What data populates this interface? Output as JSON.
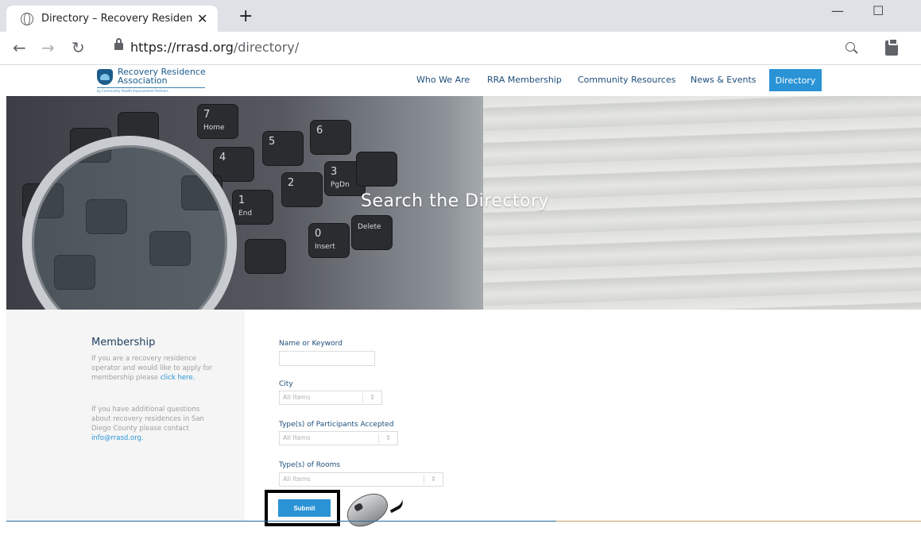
{
  "browser": {
    "tab_title": "Directory – Recovery Residence A",
    "tab_close": "✕",
    "new_tab": "+",
    "url_domain": "https://rrasd.org",
    "url_path": "/directory/",
    "win_minimize": "—",
    "win_maximize": "☐"
  },
  "site": {
    "logo_line1": "Recovery Residence",
    "logo_line2": "Association",
    "logo_tagline": "by Community Health Improvement Partners",
    "nav": [
      {
        "label": "Who We Are"
      },
      {
        "label": "RRA Membership"
      },
      {
        "label": "Community Resources"
      },
      {
        "label": "News & Events"
      },
      {
        "label": "Directory"
      }
    ]
  },
  "hero": {
    "title": "Search the Directory",
    "keys": [
      "7",
      "Home",
      "4",
      "5",
      "6",
      "1",
      "End",
      "2",
      "3",
      "PgDn",
      "0",
      "Insert",
      "Delete"
    ]
  },
  "sidebar": {
    "title": "Membership",
    "para1_text": "If you are a recovery residence operator and would like to apply for membership please",
    "para1_link": "click here.",
    "para2_text": "If you have additional questions about recovery residences in San Diego County please contact",
    "para2_link": "info@rrasd.org."
  },
  "form": {
    "keyword_label": "Name or Keyword",
    "keyword_value": "",
    "city_label": "City",
    "city_value": "All Items",
    "participants_label": "Type(s) of Participants Accepted",
    "participants_value": "All Items",
    "rooms_label": "Type(s) of Rooms",
    "rooms_value": "All Items",
    "select_arrow": "⇕",
    "submit_label": "Submit"
  },
  "colors": {
    "accent": "#2a93d5",
    "nav_text": "#1e4e7a"
  }
}
